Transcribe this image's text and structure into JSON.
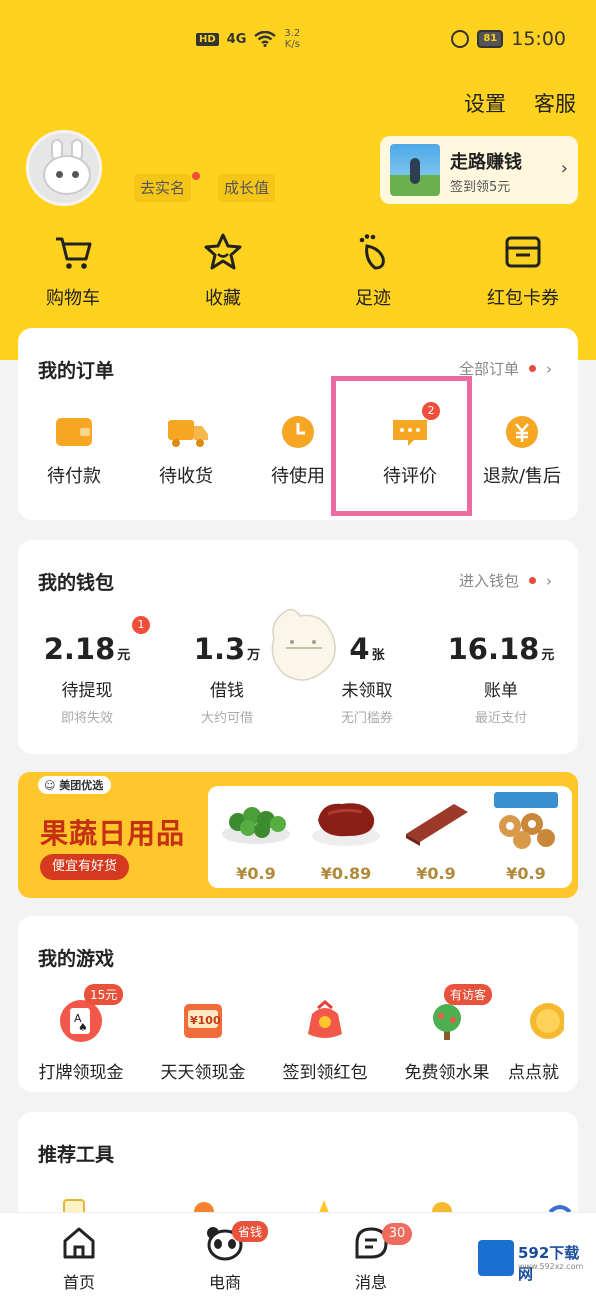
{
  "status_bar": {
    "hd": "HD",
    "signal": "4G",
    "net_speed_value": "3.2",
    "net_speed_unit": "K/s",
    "battery": "81",
    "time": "15:00"
  },
  "header": {
    "settings": "设置",
    "service": "客服",
    "verify": "去实名",
    "growth": "成长值"
  },
  "walk_card": {
    "title": "走路赚钱",
    "subtitle": "签到领5元",
    "arrow": "›"
  },
  "quick_links": [
    {
      "label": "购物车",
      "icon": "cart-icon"
    },
    {
      "label": "收藏",
      "icon": "star-icon"
    },
    {
      "label": "足迹",
      "icon": "footprint-icon"
    },
    {
      "label": "红包卡券",
      "icon": "wallet-card-icon"
    }
  ],
  "orders": {
    "title": "我的订单",
    "all_link": "全部订单",
    "arrow": "›",
    "items": [
      {
        "label": "待付款",
        "icon": "wallet-icon"
      },
      {
        "label": "待收货",
        "icon": "truck-icon"
      },
      {
        "label": "待使用",
        "icon": "clock-icon"
      },
      {
        "label": "待评价",
        "icon": "comment-icon",
        "badge": "2"
      },
      {
        "label": "退款/售后",
        "icon": "refund-icon"
      }
    ]
  },
  "wallet": {
    "title": "我的钱包",
    "enter_link": "进入钱包",
    "arrow": "›",
    "items": [
      {
        "value": "2.18",
        "unit": "元",
        "label": "待提现",
        "sub": "即将失效",
        "badge": "1"
      },
      {
        "value": "1.3",
        "unit": "万",
        "label": "借钱",
        "sub": "大约可借"
      },
      {
        "value": "4",
        "unit": "张",
        "label": "未领取",
        "sub": "无门槛券"
      },
      {
        "value": "16.18",
        "unit": "元",
        "label": "账单",
        "sub": "最近支付"
      }
    ]
  },
  "banner": {
    "brand": "美团优选",
    "title": "果蔬日用品",
    "button": "便宜有好货",
    "products": [
      {
        "price": "¥0.9",
        "icon": "lime-icon"
      },
      {
        "price": "¥0.89",
        "icon": "dried-meat-icon"
      },
      {
        "price": "¥0.9",
        "icon": "spicy-strip-icon"
      },
      {
        "price": "¥0.9",
        "icon": "cookie-icon"
      }
    ]
  },
  "games": {
    "title": "我的游戏",
    "items": [
      {
        "label": "打牌领现金",
        "tag": "15元",
        "icon": "poker-icon"
      },
      {
        "label": "天天领现金",
        "icon": "cash-card-icon",
        "icon_text": "¥100"
      },
      {
        "label": "签到领红包",
        "icon": "red-packet-icon"
      },
      {
        "label": "免费领水果",
        "tag": "有访客",
        "icon": "fruit-tree-icon"
      },
      {
        "label": "点点就",
        "icon": "coin-icon"
      }
    ]
  },
  "tools": {
    "title": "推荐工具"
  },
  "bottom_nav": {
    "items": [
      {
        "label": "首页",
        "icon": "home-icon"
      },
      {
        "label": "电商",
        "icon": "panda-icon",
        "tag": "省钱"
      },
      {
        "label": "消息",
        "icon": "message-icon",
        "badge": "30"
      }
    ]
  },
  "watermark": {
    "text": "592下载网",
    "sub": "www.592xz.com"
  },
  "colors": {
    "brand_yellow": "#ffd21f",
    "badge_red": "#ef4f3a",
    "highlight_pink": "#ea6b9f",
    "order_orange": "#f5a623"
  }
}
